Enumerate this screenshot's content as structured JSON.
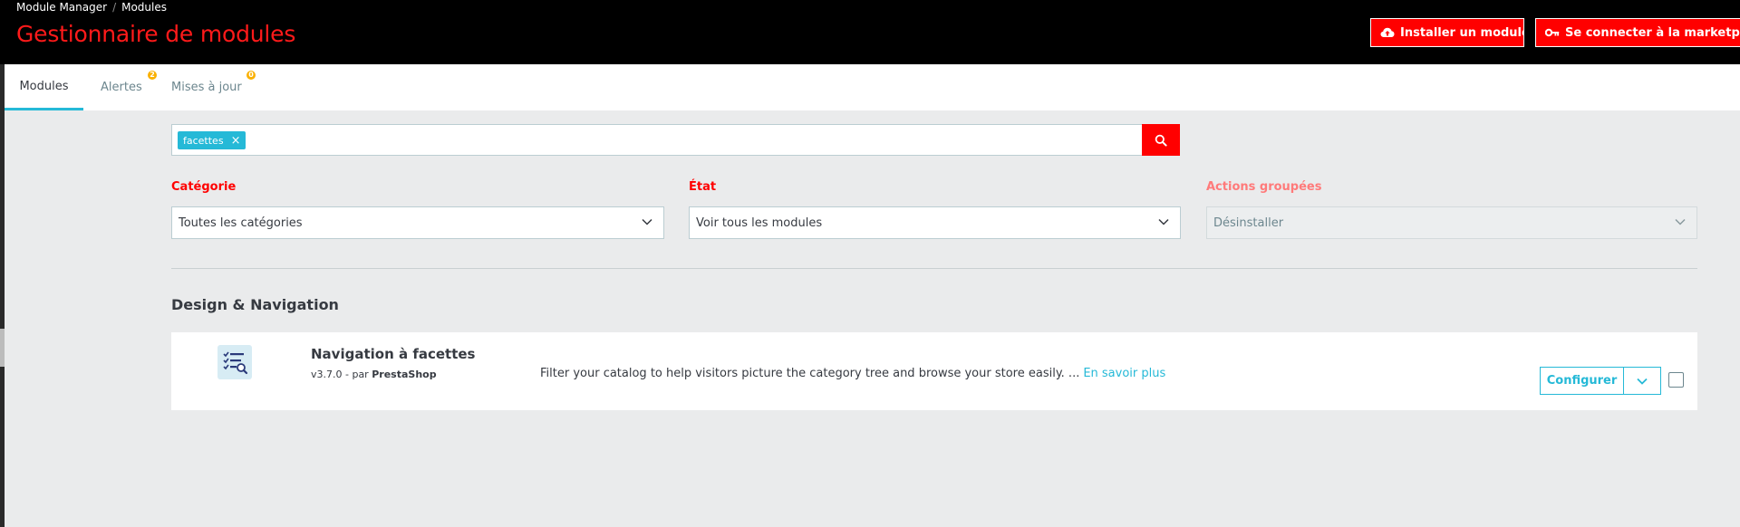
{
  "header": {
    "breadcrumb": [
      "Module Manager",
      "Modules"
    ],
    "breadcrumb_separator": "/",
    "title": "Gestionnaire de modules",
    "install_button": "Installer un module",
    "marketplace_button": "Se connecter à la marketplace A",
    "accent_color": "#ff0000"
  },
  "tabs": [
    {
      "label": "Modules",
      "active": true
    },
    {
      "label": "Alertes",
      "badge": "2"
    },
    {
      "label": "Mises à jour",
      "badge": "0"
    }
  ],
  "search": {
    "tags": [
      "facettes"
    ],
    "remove_icon": "×",
    "button_icon": "search-icon"
  },
  "filters": {
    "category": {
      "label": "Catégorie",
      "value": "Toutes les catégories"
    },
    "state": {
      "label": "État",
      "value": "Voir tous les modules"
    },
    "bulk": {
      "label": "Actions groupées",
      "value": "Désinstaller"
    }
  },
  "section": {
    "title": "Design & Navigation"
  },
  "module": {
    "name": "Navigation à facettes",
    "version": "v3.7.0 - par",
    "author": "PrestaShop",
    "description": "Filter your catalog to help visitors picture the category tree and browse your store easily. ...",
    "more_link": "En savoir plus",
    "configure_label": "Configurer",
    "link_color": "#25b9d7"
  }
}
